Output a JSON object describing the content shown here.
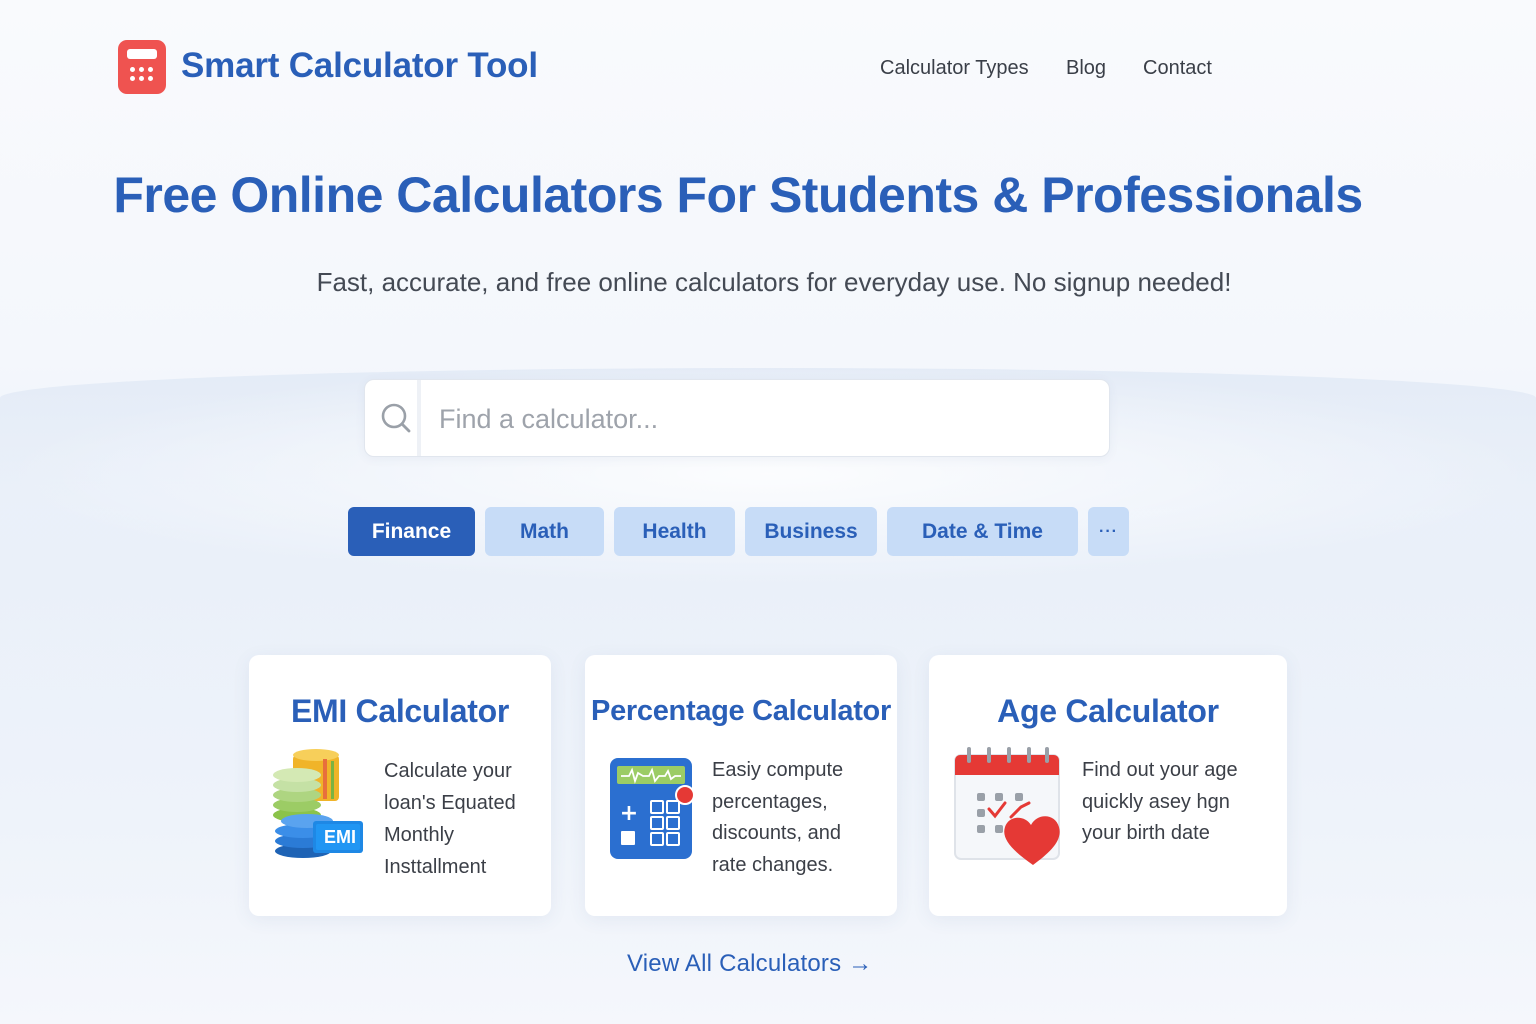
{
  "header": {
    "brand": "Smart Calculator Tool",
    "logo_icon": "calculator-icon",
    "logo_color": "#ef5350",
    "nav": [
      "Calculator Types",
      "Blog",
      "Contact"
    ]
  },
  "hero": {
    "title": "Free Online Calculators For Students & Professionals",
    "subtitle": "Fast, accurate, and free online calculators for everyday use. No signup needed!"
  },
  "search": {
    "icon": "search-icon",
    "placeholder": "Find a calculator..."
  },
  "categories": {
    "tabs": [
      "Finance",
      "Math",
      "Health",
      "Business",
      "Date & Time"
    ],
    "active": "Finance",
    "more_label": "···"
  },
  "cards": [
    {
      "title": "EMI Calculator",
      "icon": "coin-stack-icon",
      "icon_badge": "EMI",
      "desc": [
        "Calculate your",
        "loan's Equated",
        "Monthly",
        "Insttallment"
      ]
    },
    {
      "title": "Percentage Calculator",
      "icon": "calculator-icon",
      "desc": [
        "Easiy compute",
        "percentages,",
        "discounts, and",
        "rate changes."
      ]
    },
    {
      "title": "Age Calculator",
      "icon": "calendar-heart-icon",
      "desc": [
        "Find out your age",
        "quickly asey hgn",
        "your birth date"
      ]
    }
  ],
  "footer_link": "View All Calculators →",
  "colors": {
    "primary": "#2a5fb8",
    "tab_inactive": "#c7dcf7",
    "accent_red": "#ef5350"
  }
}
